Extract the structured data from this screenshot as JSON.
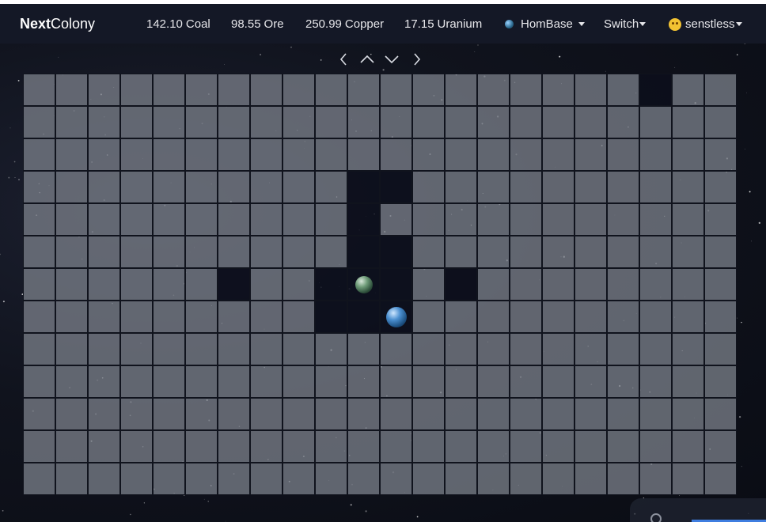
{
  "brand": {
    "bold": "Next",
    "rest": "Colony"
  },
  "resources": [
    {
      "amount": "142.10",
      "name": "Coal"
    },
    {
      "amount": "98.55",
      "name": "Ore"
    },
    {
      "amount": "250.99",
      "name": "Copper"
    },
    {
      "amount": "17.15",
      "name": "Uranium"
    }
  ],
  "planet_menu": {
    "label": "HomBase",
    "icon": "planet-icon"
  },
  "switch_menu": {
    "label": "Switch"
  },
  "user_menu": {
    "label": "senstless",
    "icon": "avatar-icon"
  },
  "navigation": {
    "left": "chevron-left-icon",
    "up": "chevron-up-icon",
    "down": "chevron-down-icon",
    "right": "chevron-right-icon"
  },
  "map": {
    "columns": 22,
    "rows": 13,
    "explored_cells": [
      [
        0,
        19
      ],
      [
        3,
        10
      ],
      [
        3,
        11
      ],
      [
        4,
        10
      ],
      [
        5,
        10
      ],
      [
        5,
        11
      ],
      [
        6,
        6
      ],
      [
        6,
        9
      ],
      [
        6,
        10
      ],
      [
        6,
        11
      ],
      [
        6,
        13
      ],
      [
        7,
        9
      ],
      [
        7,
        10
      ],
      [
        7,
        11
      ]
    ],
    "planets": [
      {
        "row": 6,
        "col": 10,
        "type": "green"
      },
      {
        "row": 7,
        "col": 11,
        "type": "blue"
      }
    ]
  },
  "colors": {
    "navbar": "#141826",
    "cell_unexplored": "#767a84",
    "cell_explored": "#0c0f1c",
    "accent": "#3f7ee0"
  }
}
